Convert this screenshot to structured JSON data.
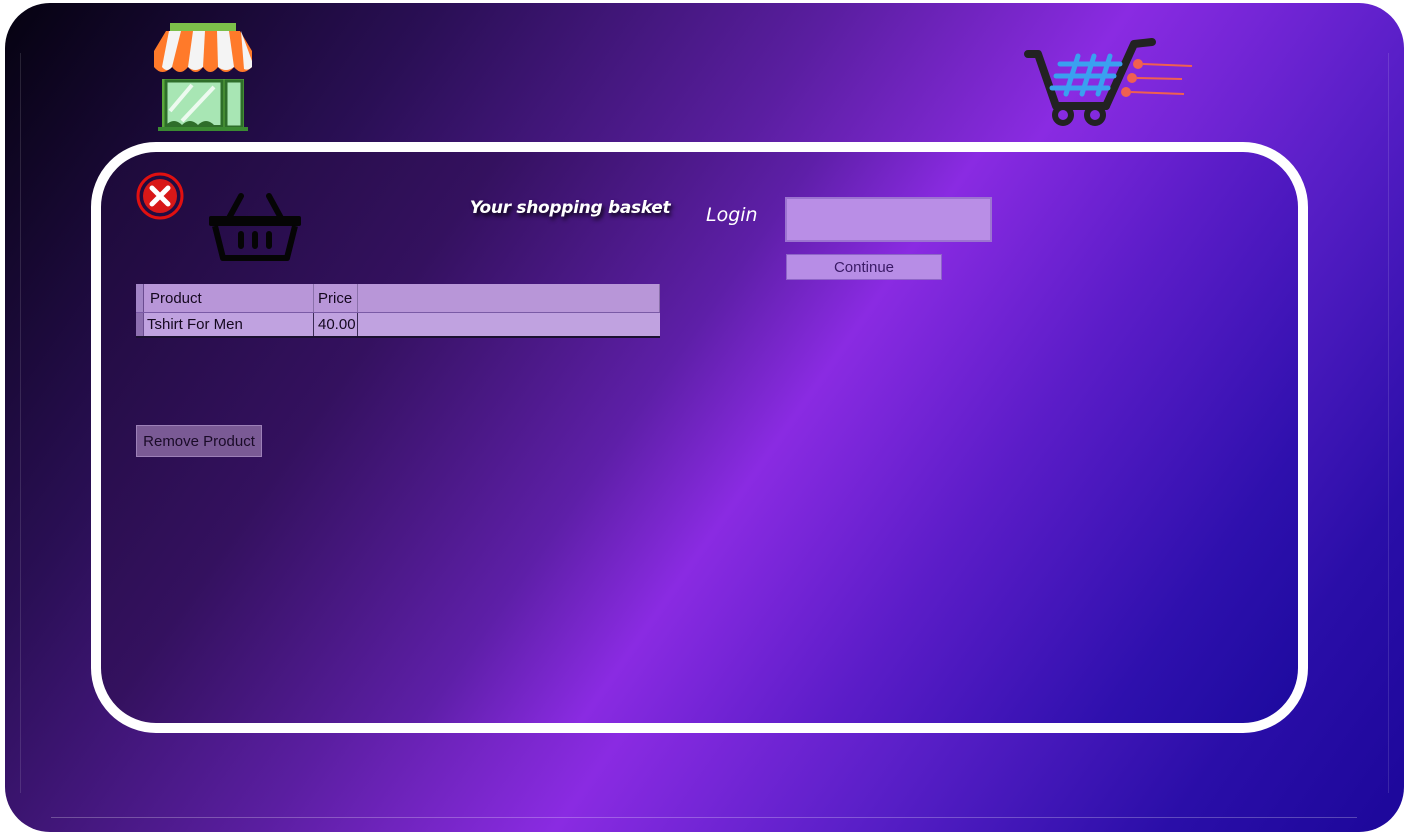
{
  "icons": {
    "store": "store-icon",
    "cart_logo": "cart-logo-icon",
    "close": "close-icon",
    "basket": "basket-icon"
  },
  "basket": {
    "title": "Your shopping basket"
  },
  "login": {
    "label": "Login",
    "input_value": "",
    "continue_label": "Continue"
  },
  "table": {
    "columns": [
      "Product",
      "Price"
    ],
    "rows": [
      {
        "product": "Tshirt For Men",
        "price": "40.00"
      }
    ]
  },
  "actions": {
    "remove_label": "Remove Product"
  },
  "colors": {
    "accent_purple": "#8a2be2",
    "close_red": "#e01010",
    "frame_white": "#ffffff"
  }
}
